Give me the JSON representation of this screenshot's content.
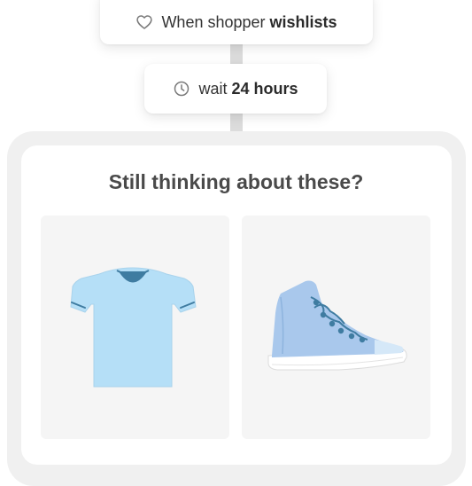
{
  "trigger": {
    "prefix": "When shopper ",
    "event": "wishlists",
    "icon": "heart-icon"
  },
  "delay": {
    "prefix": "wait ",
    "duration": "24 hours",
    "icon": "clock-icon"
  },
  "email": {
    "headline": "Still thinking about these?",
    "products": [
      {
        "name": "t-shirt",
        "icon": "t-shirt-icon",
        "color": "#b5dff7"
      },
      {
        "name": "sneaker",
        "icon": "high-top-sneaker-icon",
        "color": "#a9c8ec"
      }
    ]
  },
  "colors": {
    "connector": "#dcdcdc",
    "outer_card": "#f0f0f0",
    "tile": "#f5f5f5",
    "accent_dark": "#3f7ca1"
  }
}
